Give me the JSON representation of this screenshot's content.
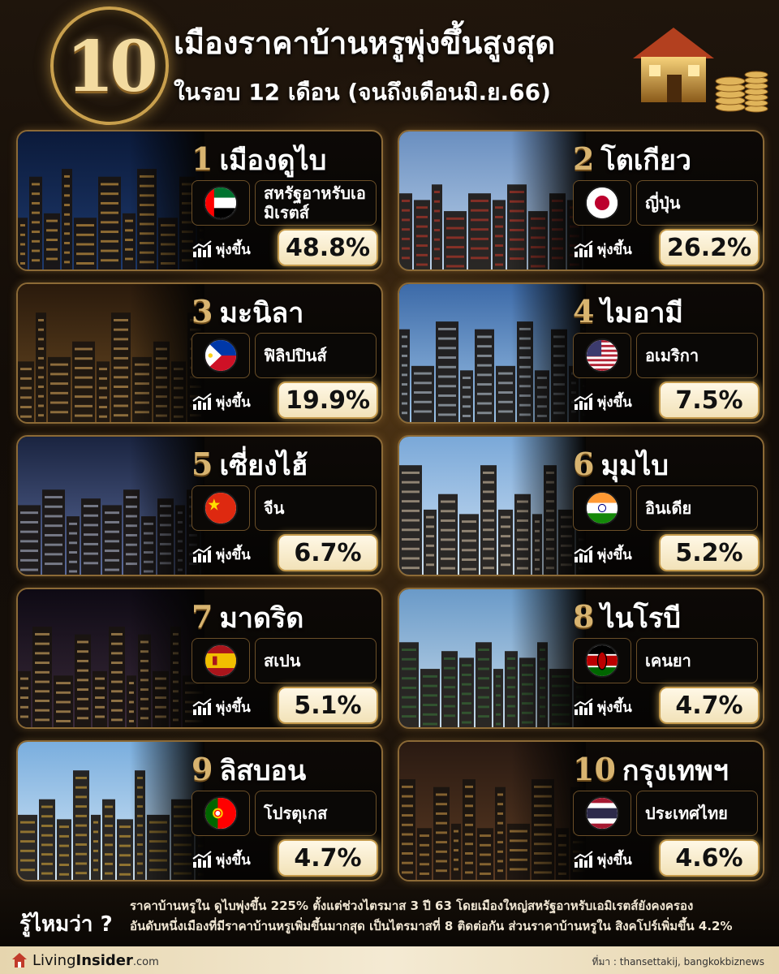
{
  "header": {
    "badge_number": "10",
    "title_line1": "เมืองราคาบ้านหรูพุ่งขึ้นสูงสุด",
    "title_line2": "ในรอบ 12 เดือน (จนถึงเดือนมิ.ย.66)"
  },
  "rise_label": "พุ่งขึ้น",
  "cities": [
    {
      "rank": "1",
      "city": "เมืองดูไบ",
      "country": "สหรัฐอาหรับเอมิเรตส์",
      "pct": "48.8%",
      "flag": "uae-flag-icon"
    },
    {
      "rank": "2",
      "city": "โตเกียว",
      "country": "ญี่ปุ่น",
      "pct": "26.2%",
      "flag": "japan-flag-icon"
    },
    {
      "rank": "3",
      "city": "มะนิลา",
      "country": "ฟิลิปปินส์",
      "pct": "19.9%",
      "flag": "philippines-flag-icon"
    },
    {
      "rank": "4",
      "city": "ไมอามี",
      "country": "อเมริกา",
      "pct": "7.5%",
      "flag": "usa-flag-icon"
    },
    {
      "rank": "5",
      "city": "เซี่ยงไฮ้",
      "country": "จีน",
      "pct": "6.7%",
      "flag": "china-flag-icon"
    },
    {
      "rank": "6",
      "city": "มุมไบ",
      "country": "อินเดีย",
      "pct": "5.2%",
      "flag": "india-flag-icon"
    },
    {
      "rank": "7",
      "city": "มาดริด",
      "country": "สเปน",
      "pct": "5.1%",
      "flag": "spain-flag-icon"
    },
    {
      "rank": "8",
      "city": "ไนโรบี",
      "country": "เคนยา",
      "pct": "4.7%",
      "flag": "kenya-flag-icon"
    },
    {
      "rank": "9",
      "city": "ลิสบอน",
      "country": "โปรตุเกส",
      "pct": "4.7%",
      "flag": "portugal-flag-icon"
    },
    {
      "rank": "10",
      "city": "กรุงเทพฯ",
      "country": "ประเทศไทย",
      "pct": "4.6%",
      "flag": "thailand-flag-icon"
    }
  ],
  "note": {
    "title": "รู้ไหมว่า ?",
    "line1": "ราคาบ้านหรูใน ดูไบพุ่งขึ้น 225% ตั้งแต่ช่วงไตรมาส 3 ปี 63 โดยเมืองใหญ่สหรัฐอาหรับเอมิเรตส์ยังคงครอง",
    "line2": "อันดับหนึ่งเมืองที่มีราคาบ้านหรูเพิ่มขึ้นมากสุด เป็นไตรมาสที่ 8 ติดต่อกัน ส่วนราคาบ้านหรูใน สิงคโปร์เพิ่มขึ้น 4.2%"
  },
  "footer": {
    "brand_a": "Living",
    "brand_b": "Insider",
    "brand_c": ".com",
    "source": "ที่มา : thansettakij, bangkokbiznews"
  },
  "colors": {
    "gold": "#c9a04d",
    "pct_bg": "#fff8e6",
    "background": "#120c07"
  }
}
